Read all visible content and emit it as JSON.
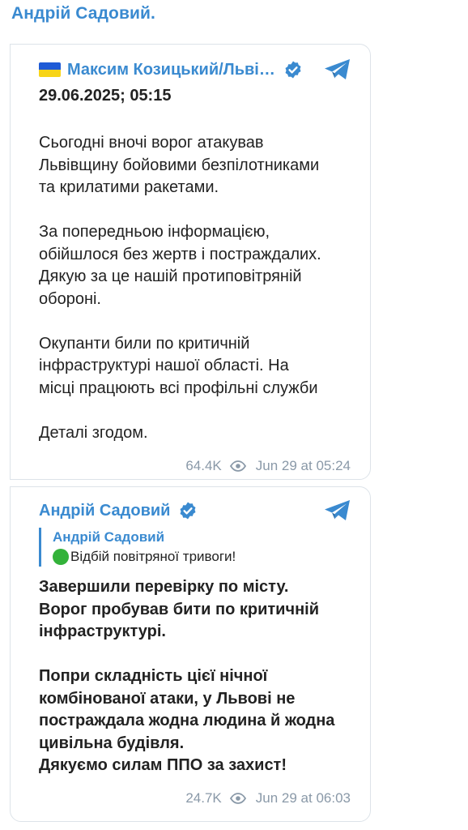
{
  "channel": {
    "title": "Андрій Садовий."
  },
  "post1": {
    "author": "Максим Козицький/Льві…",
    "date": "29.06.2025; 05:15",
    "paragraphs": [
      [
        "Сьогодні вночі ворог атакував",
        "Львівщину бойовими безпілотниками",
        "та крилатими ракетами."
      ],
      [
        "За попередньою інформацією,",
        "обійшлося без жертв і постраждалих.",
        "Дякую за це нашій протиповітряній",
        "обороні."
      ],
      [
        "Окупанти били по критичній",
        "інфраструктурі нашої області. На",
        "місці працюють всі профільні служби"
      ],
      [
        "Деталі згодом."
      ]
    ],
    "views": "64.4K",
    "time": "Jun 29 at 05:24",
    "icons": {
      "flag": "ukraine-flag-icon",
      "verified": "verified-badge-icon",
      "forward": "telegram-forward-icon",
      "views": "eye-icon"
    }
  },
  "post2": {
    "author": "Андрій Садовий",
    "quote": {
      "author": "Андрій Садовий",
      "text": "Відбій повітряної тривоги!"
    },
    "paragraphs": [
      [
        "Завершили перевірку по місту.",
        "Ворог пробував бити по критичній",
        "інфраструктурі."
      ],
      [
        "Попри складність цієї нічної",
        "комбінованої атаки, у Львові не",
        "постраждала жодна людина й жодна",
        "цивільна будівля.",
        "Дякуємо силам ППО за захист!"
      ]
    ],
    "views": "24.7K",
    "time": "Jun 29 at 06:03"
  },
  "colors": {
    "accent": "#3a8ad0",
    "meta": "#8a99a8",
    "border": "#dde3e9",
    "flag_blue": "#1f5bd6",
    "flag_yellow": "#f7d417",
    "green": "#33b23a"
  }
}
